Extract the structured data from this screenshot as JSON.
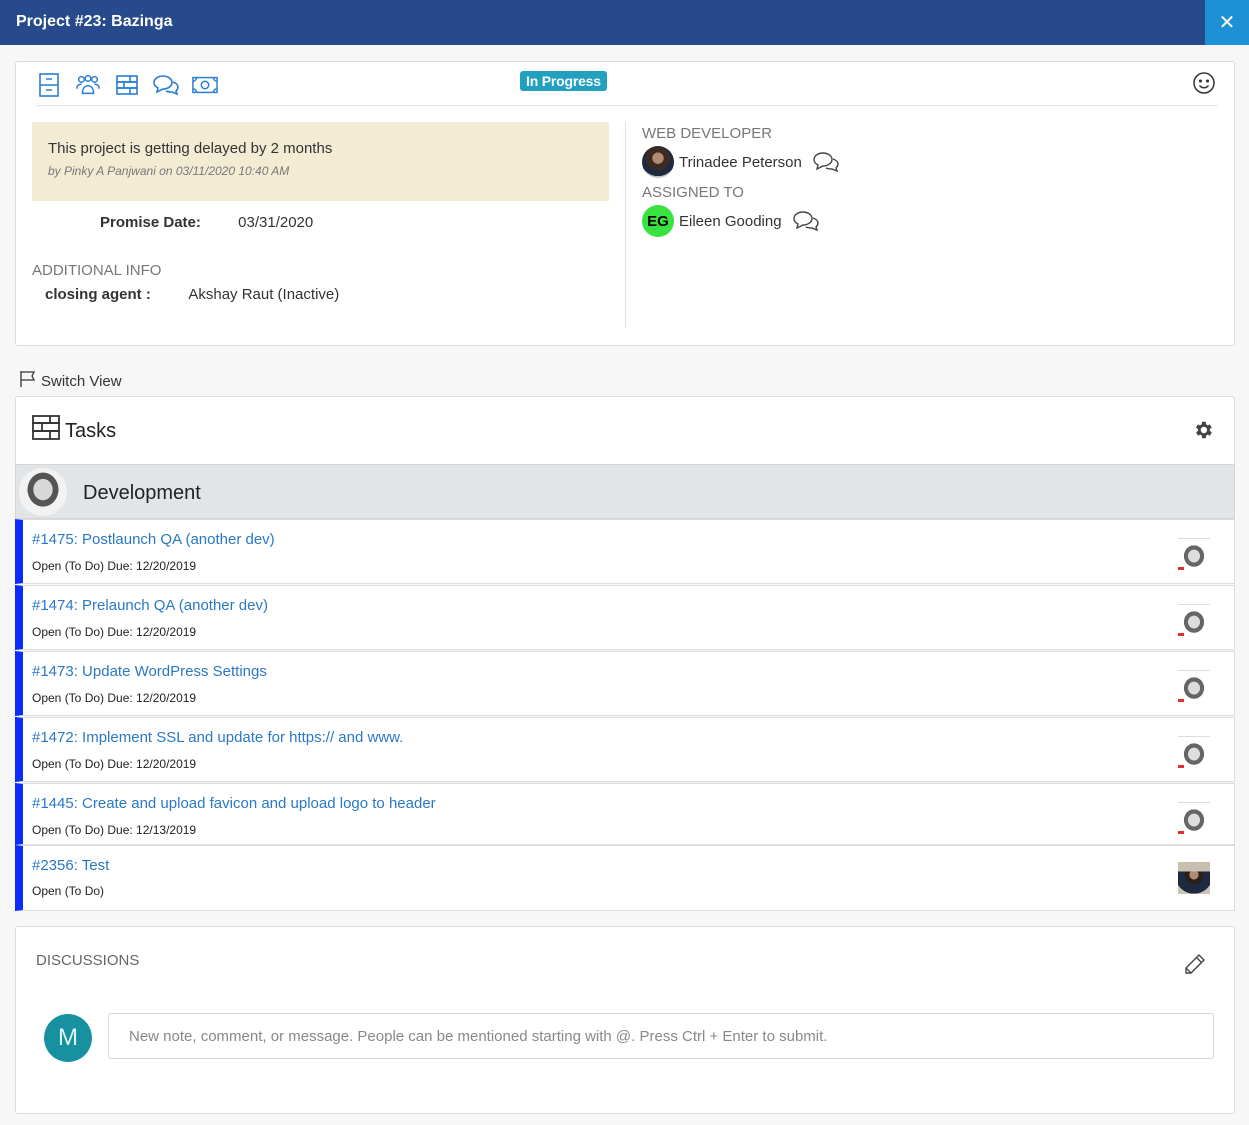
{
  "window": {
    "title": "Project #23: Bazinga",
    "close_icon": "close-icon"
  },
  "toolbar": {
    "icons": [
      "cabinet-icon",
      "users-icon",
      "tasks-icon",
      "chat-icon",
      "money-icon"
    ],
    "status": "In Progress",
    "status_color": "#21a0c0",
    "right_icon": "smiley-icon"
  },
  "note": {
    "text": "This project is getting delayed by 2 months",
    "by": "by Pinky A Panjwani on 03/11/2020 10:40 AM"
  },
  "promise": {
    "label": "Promise Date:",
    "value": "03/31/2020"
  },
  "additional_info": {
    "title": "ADDITIONAL INFO",
    "label": "closing agent :",
    "value": "Akshay Raut (Inactive)"
  },
  "people": {
    "web_developer": {
      "role": "WEB DEVELOPER",
      "name": "Trinadee Peterson"
    },
    "assigned_to": {
      "role": "ASSIGNED TO",
      "name": "Eileen Gooding",
      "initials": "EG",
      "color": "#39e23e"
    }
  },
  "switch_view": "Switch View",
  "tasks": {
    "title": "Tasks",
    "group": "Development",
    "accent_color": "#0a2cff",
    "items": [
      {
        "title": "#1475: Postlaunch QA (another dev)",
        "meta": "Open (To Do) Due: 12/20/2019"
      },
      {
        "title": "#1474: Prelaunch QA (another dev)",
        "meta": "Open (To Do) Due: 12/20/2019"
      },
      {
        "title": "#1473: Update WordPress Settings",
        "meta": "Open (To Do) Due: 12/20/2019"
      },
      {
        "title": "#1472: Implement SSL and update for https:// and www.",
        "meta": "Open (To Do) Due: 12/20/2019"
      },
      {
        "title": "#1445: Create and upload favicon and upload logo to header",
        "meta": "Open (To Do) Due: 12/13/2019"
      },
      {
        "title": "#2356: Test",
        "meta": "Open (To Do)"
      }
    ]
  },
  "discussions": {
    "title": "DISCUSSIONS",
    "user_initial": "M",
    "placeholder": "New note, comment, or message. People can be mentioned starting with @. Press Ctrl + Enter to submit."
  }
}
